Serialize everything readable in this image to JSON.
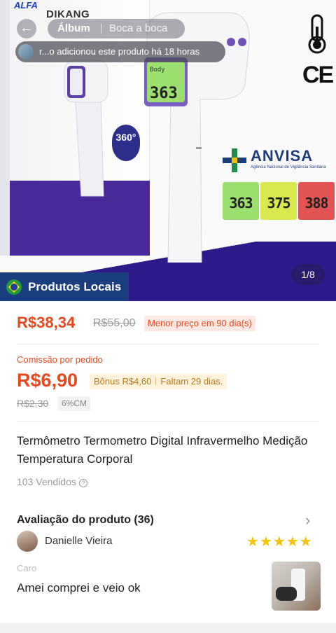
{
  "header": {
    "back_icon": "back-arrow-icon",
    "tabs": [
      {
        "label": "Álbum",
        "active": true
      },
      {
        "label": "Boca a boca",
        "active": false
      }
    ],
    "notice": "r...o adicionou este produto há 18 horas"
  },
  "product_image": {
    "brand": "ALFA",
    "maker": "DIKANG",
    "badge": "360°",
    "certification": "ANVISA",
    "certification_sub": "Agência Nacional de Vigilância Sanitária",
    "ce_mark": "CE",
    "displays": [
      "363",
      "375",
      "388"
    ],
    "big_display": "363",
    "page_indicator": "1/8",
    "locais_label": "Produtos Locais"
  },
  "pricing": {
    "price": "R$38,34",
    "old_price": "R$55,00",
    "low_price_tag": "Menor preço em 90 dia(s)",
    "commission_label": "Comissão por pedido",
    "commission_value": "R$6,90",
    "bonus": "Bônus R$4,60",
    "remaining": "Faltam 29 dias.",
    "commission_old": "R$2,30",
    "commission_rate": "6%CM"
  },
  "product": {
    "title": "Termômetro Termometro Digital Infravermelho Medição Temperatura Corporal",
    "sold": "103 Vendidos"
  },
  "reviews": {
    "title": "Avaliação do produto (36)",
    "reviewer": "Danielle Vieira",
    "rating": 5,
    "label": "Caro",
    "text": "Amei comprei e veio ok"
  },
  "colors": {
    "accent": "#e8481e",
    "locais_bg": "#1a3d7d",
    "star": "#f5c400"
  }
}
